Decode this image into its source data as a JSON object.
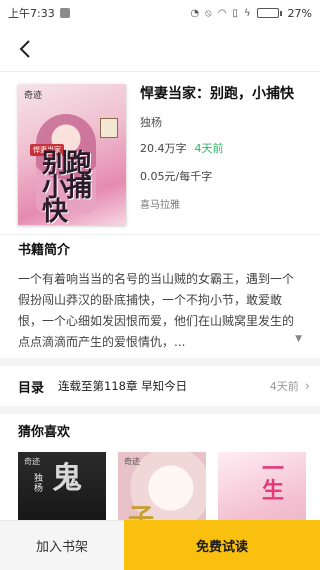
{
  "status_bar": {
    "time": "上午7:33",
    "battery": "27%",
    "battery_level": 0.27,
    "icons": [
      "notification-icon",
      "alarm-icon",
      "mute-icon",
      "wifi-icon",
      "sim-icon",
      "charging-icon",
      "battery-icon"
    ]
  },
  "nav": {
    "back_icon": "back-arrow-icon"
  },
  "book": {
    "title": "悍妻当家：别跑，小捕快",
    "author": "独杨",
    "word_count": "20.4万字",
    "updated": "4天前",
    "price": "0.05元/每千字",
    "publisher": "喜马拉雅",
    "cover": {
      "tag": "奇迹",
      "title": "别跑小捕快",
      "badge": "悍妻当家"
    }
  },
  "synopsis": {
    "title": "书籍简介",
    "text": "一个有着响当当的名号的当山贼的女霸王，遇到一个假扮闯山莽汉的卧底捕快，一个不拘小节，敢爱敢恨，一个心细如发因恨而爱，他们在山贼窝里发生的点点滴滴而产生的爱恨情仇，...",
    "expand_icon": "expand-down-icon"
  },
  "catalog": {
    "label": "目录",
    "latest": "连载至第118章 早知今日",
    "time": "4天前"
  },
  "recommendations": {
    "title": "猜你喜欢",
    "items": [
      {
        "cover_tag": "奇迹",
        "cover_text": "鬼",
        "cover_sub": "独杨"
      },
      {
        "cover_tag": "奇迹",
        "cover_text": "子"
      },
      {
        "cover_text": "一生"
      }
    ]
  },
  "bottom": {
    "add_shelf": "加入书架",
    "free_read": "免费试读"
  },
  "colors": {
    "accent": "#f9c00f",
    "updated_green": "#36b36b",
    "divider": "#f4f4f4"
  }
}
